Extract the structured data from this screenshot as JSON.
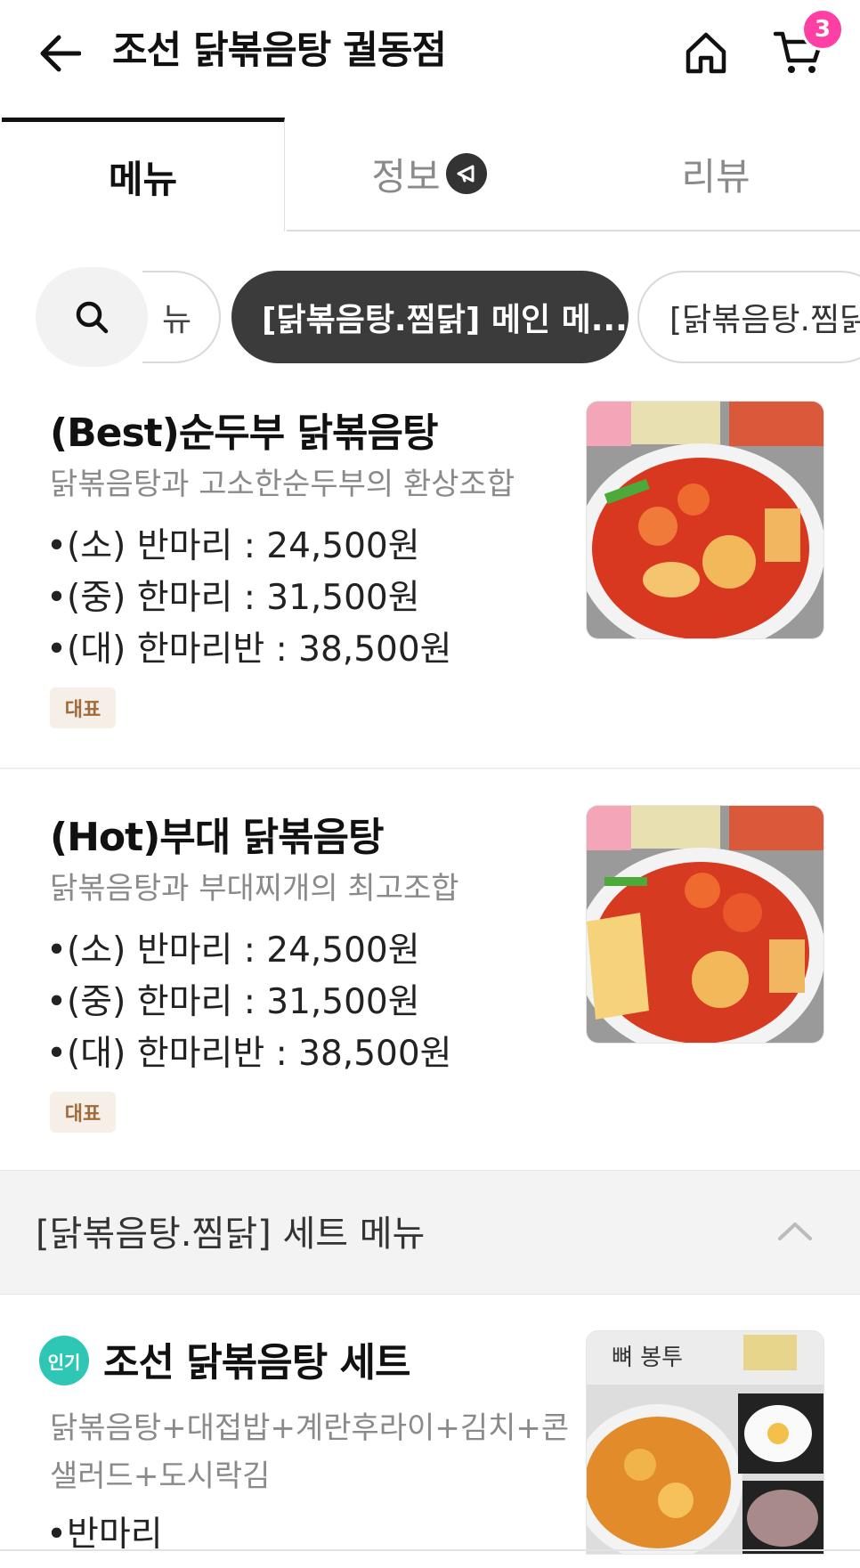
{
  "header": {
    "title": "조선 닭볶음탕 궐동점",
    "cart_count": "3"
  },
  "tabs": [
    {
      "label": "메뉴",
      "active": true
    },
    {
      "label": "정보",
      "active": false
    },
    {
      "label": "리뷰",
      "active": false
    }
  ],
  "chips": {
    "prev_fragment": "뉴",
    "active": "[닭볶음탕.찜닭] 메인 메...",
    "next": "[닭볶음탕.찜닭"
  },
  "items": [
    {
      "name": "(Best)순두부 닭볶음탕",
      "desc": "닭볶음탕과 고소한순두부의 환상조합",
      "prices": [
        "•(소) 반마리 : 24,500원",
        "•(중) 한마리 : 31,500원",
        "•(대) 한마리반 : 38,500원"
      ],
      "badge": "대표"
    },
    {
      "name": "(Hot)부대 닭볶음탕",
      "desc": "닭볶음탕과 부대찌개의 최고조합",
      "prices": [
        "•(소) 반마리 : 24,500원",
        "•(중) 한마리 : 31,500원",
        "•(대) 한마리반 : 38,500원"
      ],
      "badge": "대표"
    }
  ],
  "section": {
    "title": "[닭볶음탕.찜닭] 세트 메뉴"
  },
  "set_item": {
    "badge": "인기",
    "name": "조선 닭볶음탕 세트",
    "desc_line1": "닭볶음탕+대접밥+계란후라이+김치+콘",
    "desc_line2": "샐러드+도시락김",
    "price_first": "•반마리",
    "thumb_text": "뼈 봉투"
  },
  "colors": {
    "accent_pink": "#ff3fa4",
    "chip_active": "#3b3b3b",
    "badge_rep_bg": "#f5efe8",
    "badge_rep_text": "#a06a3a",
    "badge_pop": "#2ec7b6"
  }
}
